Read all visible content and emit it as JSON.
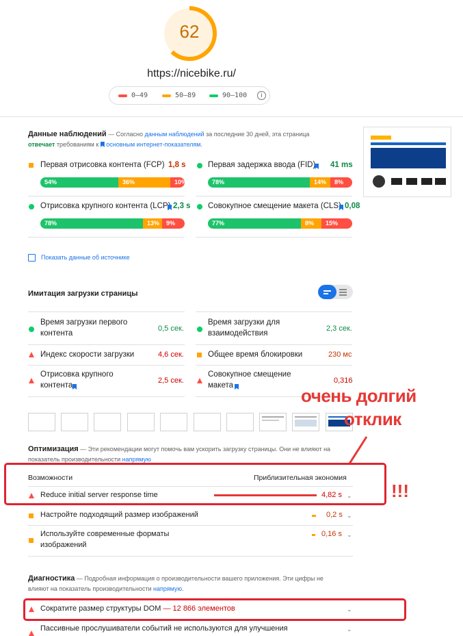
{
  "score": {
    "value": "62",
    "url": "https://nicebike.ru/"
  },
  "legend": {
    "range_bad": "0–49",
    "range_avg": "50–89",
    "range_good": "90–100",
    "info_icon": "info-icon"
  },
  "field_data": {
    "title": "Данные наблюдений",
    "desc_dash": " — ",
    "desc_a": "Согласно ",
    "desc_link": "данным наблюдений",
    "desc_b": " за последние 30 дней, эта страница ",
    "desc_pass": "отвечает",
    "desc_c": " требованиям к ",
    "desc_link2": "основным интернет-показателям",
    "desc_d": ".",
    "metrics": [
      {
        "label": "Первая отрисовка контента (FCP)",
        "value": "1,8 s",
        "pcts": [
          "54%",
          "36%",
          "10%"
        ],
        "fracs": [
          0.54,
          0.36,
          0.1
        ]
      },
      {
        "label": "Первая задержка ввода (FID)",
        "value": "41 ms",
        "pcts": [
          "78%",
          "14%",
          "8%"
        ],
        "fracs": [
          0.78,
          0.14,
          0.08
        ]
      },
      {
        "label": "Отрисовка крупного контента (LCP)",
        "value": "2,3 s",
        "pcts": [
          "78%",
          "13%",
          "9%"
        ],
        "fracs": [
          0.78,
          0.13,
          0.09
        ]
      },
      {
        "label": "Совокупное смещение макета (CLS)",
        "value": "0,08",
        "pcts": [
          "77%",
          "8%",
          "15%"
        ],
        "fracs": [
          0.77,
          0.08,
          0.15
        ]
      }
    ],
    "show_origin": "Показать данные об источнике"
  },
  "lab": {
    "title": "Имитация загрузки страницы",
    "metrics": [
      {
        "label1": "Время загрузки первого",
        "label2": "контента",
        "value": "0,5 сек."
      },
      {
        "label1": "Время загрузки для",
        "label2": "взаимодействия",
        "value": "2,3 сек."
      },
      {
        "label1": "Индекс скорости загрузки",
        "label2": "",
        "value": "4,6 сек."
      },
      {
        "label1": "Общее время блокировки",
        "label2": "",
        "value": "230 мс"
      },
      {
        "label1": "Отрисовка крупного",
        "label2": "контента",
        "value": "2,5 сек."
      },
      {
        "label1": "Совокупное смещение",
        "label2": "макета",
        "value": "0,316"
      }
    ]
  },
  "annotation": {
    "line1": "очень долгий",
    "line2": "отклик",
    "exclaim": "!!!"
  },
  "opportunities": {
    "title": "Оптимизация",
    "desc": " — Эти рекомендации могут помочь вам ускорить загрузку страницы. Они не влияют на",
    "desc2": "показатель производительности ",
    "desc2_link": "напрямую",
    "col1": "Возможности",
    "col2": "Приблизительная экономия",
    "items": [
      {
        "label": "Reduce initial server response time",
        "value": "4,82 s"
      },
      {
        "label": "Настройте подходящий размер изображений",
        "value": "0,2 s"
      },
      {
        "label1": "Используйте современные форматы",
        "label2": "изображений",
        "value": "0,16 s"
      }
    ]
  },
  "diagnostics": {
    "title": "Диагностика",
    "desc": " — Подробная информация о производительности вашего приложения. Эти цифры не",
    "desc2": "влияют на показатель производительности ",
    "desc2_link": "напрямую",
    "items": [
      {
        "label": "Сократите размер структуры DOM",
        "extra": "— 12 866 элементов"
      },
      {
        "label": "Пассивные прослушиватели событий не используются для улучшения"
      }
    ]
  }
}
